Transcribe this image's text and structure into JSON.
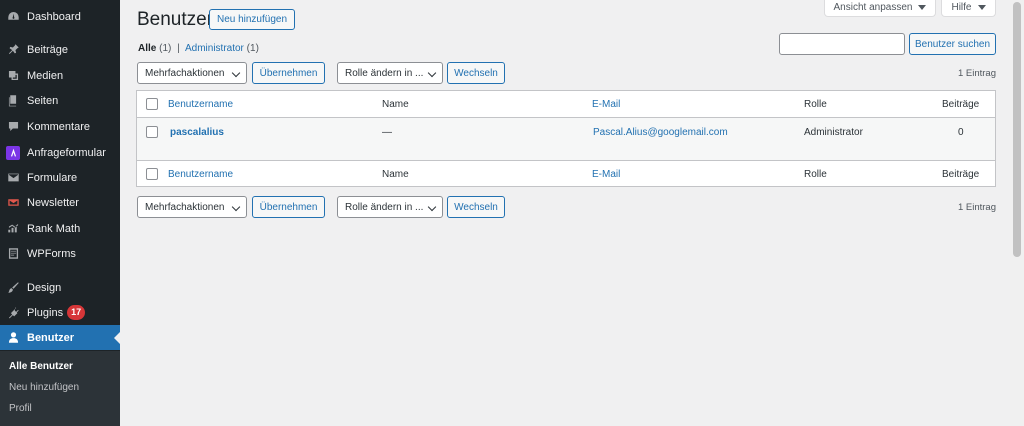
{
  "sidebar": {
    "items": [
      {
        "label": "Dashboard",
        "icon": "dashboard-icon"
      },
      {
        "label": "Beiträge",
        "icon": "pin-icon"
      },
      {
        "label": "Medien",
        "icon": "media-icon"
      },
      {
        "label": "Seiten",
        "icon": "pages-icon"
      },
      {
        "label": "Kommentare",
        "icon": "comment-icon"
      },
      {
        "label": "Anfrageformular",
        "icon": "form-plugin-icon"
      },
      {
        "label": "Formulare",
        "icon": "mail-icon"
      },
      {
        "label": "Newsletter",
        "icon": "newsletter-icon"
      },
      {
        "label": "Rank Math",
        "icon": "chart-icon"
      },
      {
        "label": "WPForms",
        "icon": "wpforms-icon"
      },
      {
        "label": "Design",
        "icon": "brush-icon"
      },
      {
        "label": "Plugins",
        "icon": "plug-icon",
        "badge": "17"
      },
      {
        "label": "Benutzer",
        "icon": "user-icon"
      }
    ],
    "submenu": [
      {
        "label": "Alle Benutzer"
      },
      {
        "label": "Neu hinzufügen"
      },
      {
        "label": "Profil"
      }
    ]
  },
  "header": {
    "title": "Benutzer",
    "add_new": "Neu hinzufügen",
    "screen_options": "Ansicht anpassen",
    "help": "Hilfe"
  },
  "views": {
    "all_label": "Alle",
    "all_count": "(1)",
    "separator": "|",
    "admin_label": "Administrator",
    "admin_count": "(1)"
  },
  "search": {
    "value": "",
    "button": "Benutzer suchen"
  },
  "bulk": {
    "actions_select": "Mehrfachaktionen",
    "apply": "Übernehmen",
    "role_select": "Rolle ändern in ...",
    "change": "Wechseln",
    "count": "1 Eintrag"
  },
  "table": {
    "columns": [
      "Benutzername",
      "Name",
      "E-Mail",
      "Rolle",
      "Beiträge"
    ],
    "rows": [
      {
        "username": "pascalalius",
        "name": "—",
        "email": "Pascal.Alius@googlemail.com",
        "role": "Administrator",
        "posts": "0"
      }
    ]
  },
  "colors": {
    "sidebar_bg": "#1d2327",
    "accent": "#2271b1",
    "badge": "#d63638",
    "content_bg": "#f0f0f1"
  }
}
